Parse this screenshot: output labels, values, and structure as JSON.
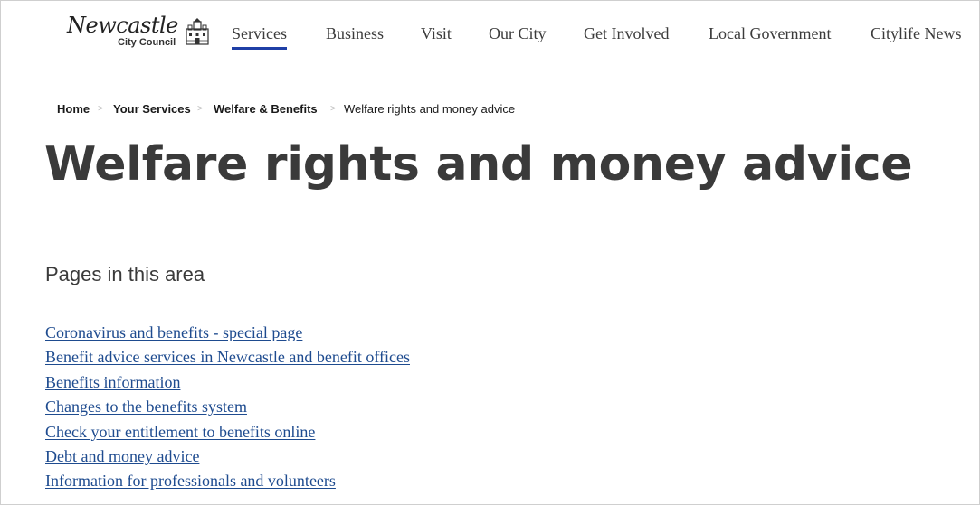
{
  "logo": {
    "name": "Newcastle",
    "subtitle": "City Council",
    "icon": "city-castle-icon"
  },
  "nav": {
    "items": [
      {
        "label": "Services",
        "active": true
      },
      {
        "label": "Business",
        "active": false
      },
      {
        "label": "Visit",
        "active": false
      },
      {
        "label": "Our City",
        "active": false
      },
      {
        "label": "Get Involved",
        "active": false
      },
      {
        "label": "Local Government",
        "active": false
      },
      {
        "label": "Citylife News",
        "active": false
      }
    ],
    "active_underline_color": "#1f3fa6"
  },
  "breadcrumb": {
    "items": [
      "Home",
      "Your Services",
      "Welfare & Benefits",
      "Welfare rights and money advice"
    ],
    "separator": ">"
  },
  "page": {
    "title": "Welfare rights and money advice",
    "section_heading": "Pages in this area",
    "link_color": "#1e4b8f",
    "links": [
      "Coronavirus and benefits - special page",
      "Benefit advice services in Newcastle and benefit offices",
      "Benefits information",
      "Changes to the benefits system",
      "Check your entitlement to benefits online",
      "Debt and money advice",
      "Information for professionals and volunteers"
    ]
  }
}
